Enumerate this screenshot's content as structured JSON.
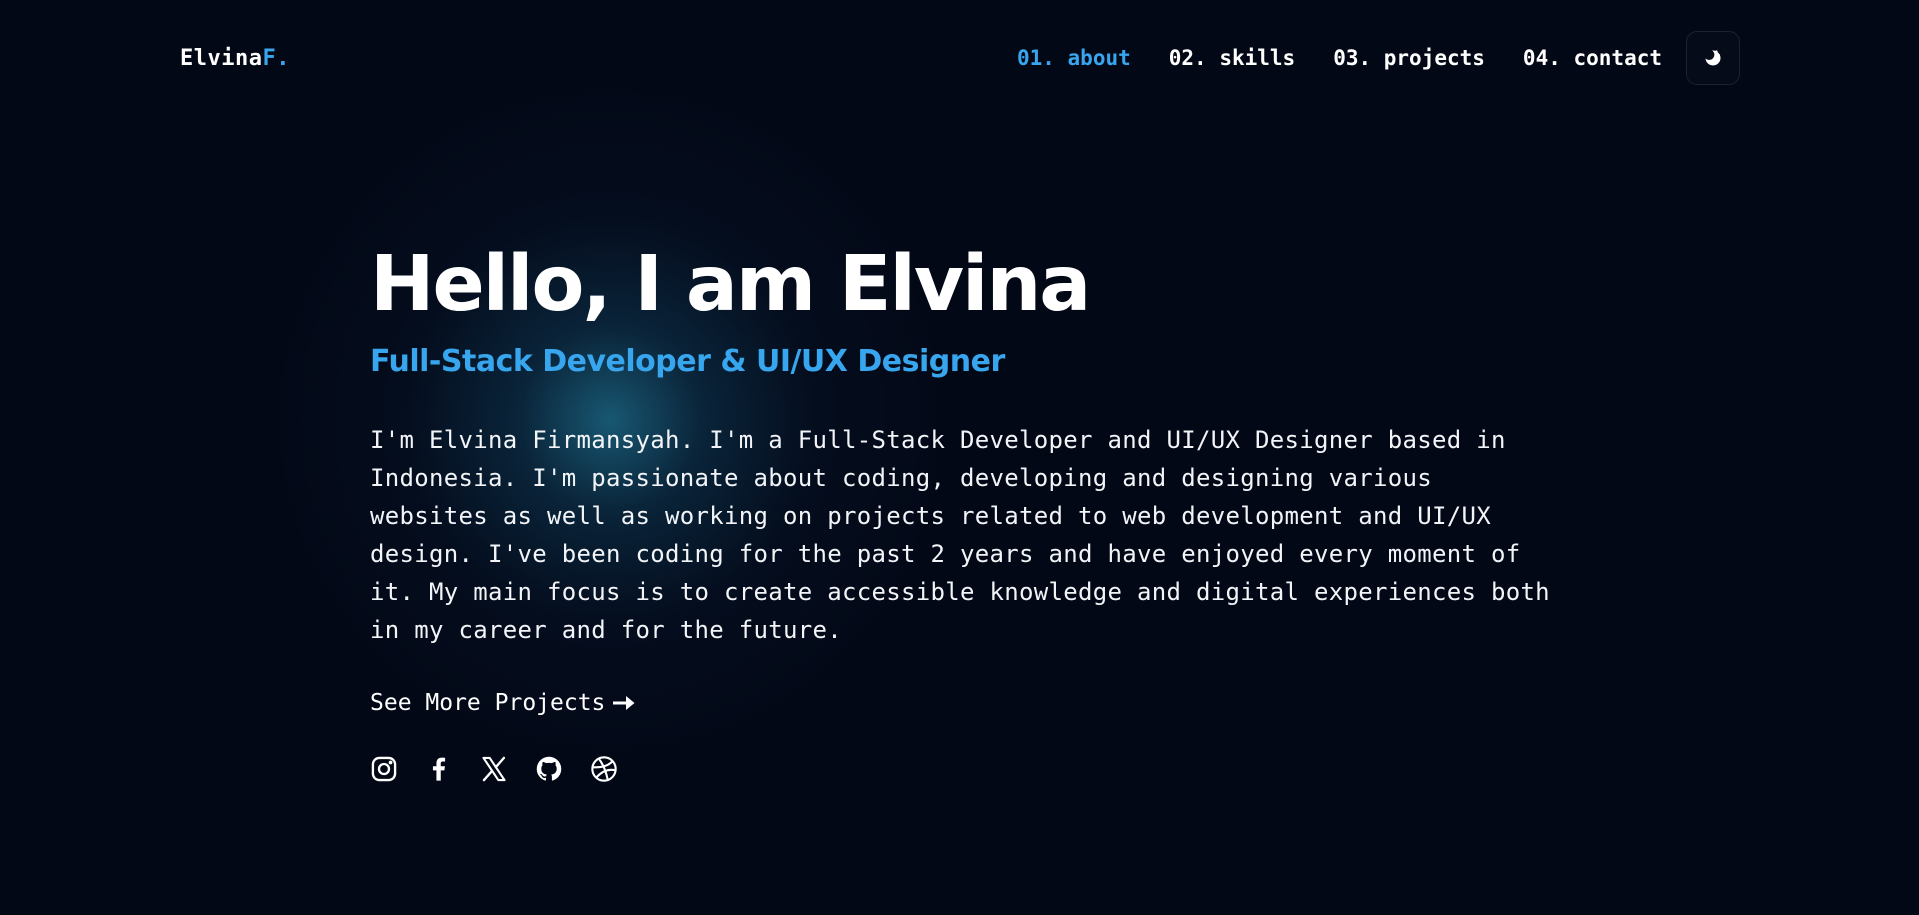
{
  "brand": {
    "name": "Elvina",
    "accent": "F."
  },
  "nav": {
    "items": [
      {
        "label": "01. about",
        "active": true
      },
      {
        "label": "02. skills",
        "active": false
      },
      {
        "label": "03. projects",
        "active": false
      },
      {
        "label": "04. contact",
        "active": false
      }
    ],
    "theme_toggle_icon": "moon-icon"
  },
  "hero": {
    "heading": "Hello, I am Elvina",
    "subheading": "Full-Stack Developer & UI/UX Designer",
    "bio": "I'm Elvina Firmansyah. I'm a Full-Stack Developer and UI/UX Designer based in Indonesia. I'm passionate about coding, developing and designing various websites as well as working on projects related to web development and UI/UX design. I've been coding for the past 2 years and have enjoyed every moment of it. My main focus is to create accessible knowledge and digital experiences both in my career and for the future.",
    "cta_label": "See More Projects",
    "cta_icon": "arrow-right-icon"
  },
  "socials": [
    "instagram-icon",
    "facebook-icon",
    "x-icon",
    "github-icon",
    "dribbble-icon"
  ],
  "colors": {
    "background": "#030816",
    "accent": "#38a6ee",
    "text": "#ffffff",
    "glow": "#1e6e8c"
  }
}
